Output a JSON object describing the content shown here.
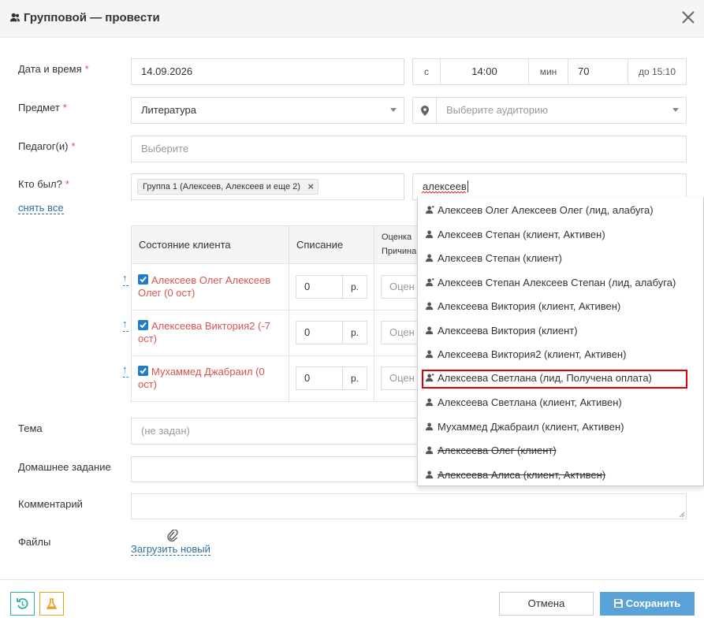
{
  "header": {
    "title": "Групповой — провести"
  },
  "form": {
    "date_label": "Дата и время",
    "date_value": "14.09.2026",
    "from_prefix": "с",
    "time_value": "14:00",
    "min_label": "мин",
    "duration_value": "70",
    "until_text": "до 15:10",
    "subject_label": "Предмет",
    "subject_value": "Литература",
    "room_placeholder": "Выберите аудиторию",
    "teacher_label": "Педагог(и)",
    "teacher_placeholder": "Выберите",
    "who_label": "Кто был?",
    "required_mark": "*",
    "group_tag": "Группа 1 (Алексеев, Алексеев и еще 2)",
    "deselect_all": "снять все",
    "search_value": "алексеев",
    "topic_label": "Тема",
    "topic_placeholder": "(не задан)",
    "homework_label": "Домашнее задание",
    "comment_label": "Комментарий",
    "files_label": "Файлы",
    "upload_link": "Загрузить новый"
  },
  "table": {
    "headers": [
      "Состояние клиента",
      "Списание",
      "Оценка",
      "Причина"
    ],
    "rows": [
      {
        "name": "Алексеев Олег Алексеев Олег (0 ост)",
        "amount": "0",
        "currency": "р.",
        "grade_placeholder": "Оцен"
      },
      {
        "name": "Алексеева Виктория2 (-7 ост)",
        "amount": "0",
        "currency": "р.",
        "grade_placeholder": "Оцен"
      },
      {
        "name": "Мухаммед Джабраил (0 ост)",
        "amount": "0",
        "currency": "р.",
        "grade_placeholder": "Оцен"
      }
    ],
    "arrow_glyph": "↑"
  },
  "dropdown": {
    "items": [
      {
        "label": "Алексеев Олег Алексеев Олег (лид, алабуга)",
        "icon": "lead-icon"
      },
      {
        "label": "Алексеев Степан (клиент, Активен)",
        "icon": "client-icon"
      },
      {
        "label": "Алексеев Степан (клиент)",
        "icon": "client-icon"
      },
      {
        "label": "Алексеев Степан Алексеев Степан (лид, алабуга)",
        "icon": "lead-icon"
      },
      {
        "label": "Алексеева Виктория (клиент, Активен)",
        "icon": "client-icon"
      },
      {
        "label": "Алексеева Виктория (клиент)",
        "icon": "client-icon"
      },
      {
        "label": "Алексеева Виктория2 (клиент, Активен)",
        "icon": "client-icon"
      },
      {
        "label": "Алексеева Светлана (лид, Получена оплата)",
        "icon": "lead-icon",
        "highlighted": true
      },
      {
        "label": "Алексеева Светлана (клиент, Активен)",
        "icon": "client-icon"
      },
      {
        "label": "Мухаммед Джабраил (клиент, Активен)",
        "icon": "client-icon"
      },
      {
        "label": "Алексеева Олег (клиент)",
        "icon": "client-icon",
        "struck": true
      },
      {
        "label": "Алексеева Алиса (клиент, Активен)",
        "icon": "client-icon",
        "struck": true
      }
    ]
  },
  "footer": {
    "cancel_label": "Отмена",
    "save_label": "Сохранить"
  },
  "colors": {
    "accent": "#5aa3d8",
    "required": "#d9534f",
    "link": "#2f6f9b",
    "highlight_border": "#dd0000",
    "restore_icon": "#2ab0a6",
    "beaker_icon": "#e6a11a"
  }
}
